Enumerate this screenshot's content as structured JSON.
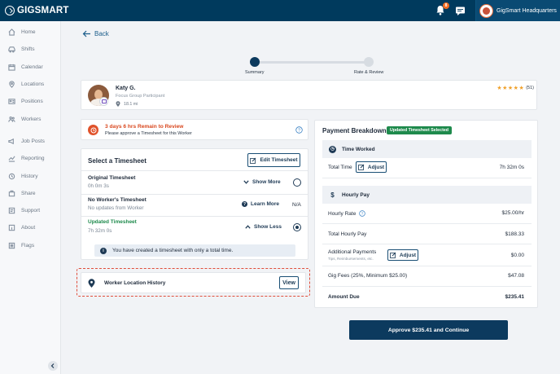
{
  "brand": {
    "name": "GIGSMART"
  },
  "header": {
    "notification_count": "8",
    "org_name": "GigSmart Headquarters"
  },
  "sidebar": {
    "items": [
      {
        "label": "Home",
        "icon": "home-icon"
      },
      {
        "label": "Shifts",
        "icon": "car-icon"
      },
      {
        "label": "Calendar",
        "icon": "calendar-icon"
      },
      {
        "label": "Locations",
        "icon": "location-pin-icon"
      },
      {
        "label": "Positions",
        "icon": "id-card-icon"
      },
      {
        "label": "Workers",
        "icon": "people-icon"
      },
      {
        "label": "Job Posts",
        "icon": "megaphone-icon"
      },
      {
        "label": "Reporting",
        "icon": "chart-icon"
      },
      {
        "label": "History",
        "icon": "history-icon"
      },
      {
        "label": "Share",
        "icon": "share-icon"
      },
      {
        "label": "Support",
        "icon": "support-icon"
      },
      {
        "label": "About",
        "icon": "info-icon"
      },
      {
        "label": "Flags",
        "icon": "flag-icon"
      }
    ]
  },
  "nav": {
    "back_label": "Back"
  },
  "stepper": {
    "steps": [
      "Summary",
      "Rate & Review"
    ],
    "active_index": 0
  },
  "worker": {
    "name": "Katy G.",
    "role": "Focus Group Participant",
    "distance": "18.1 mi",
    "rating": 5,
    "review_count": "(51)"
  },
  "alert": {
    "title": "3 days 6 hrs Remain to Review",
    "subtitle": "Please approve a Timesheet for this Worker"
  },
  "timesheet": {
    "title": "Select a Timesheet",
    "edit_label": "Edit Timesheet",
    "rows": [
      {
        "title": "Original Timesheet",
        "subtitle": "0h 0m 3s",
        "action": "Show More",
        "selected": false
      },
      {
        "title": "No Worker's Timesheet",
        "subtitle": "No updates from Worker",
        "action": "Learn More",
        "status": "N/A"
      },
      {
        "title": "Updated Timesheet",
        "subtitle": "7h 32m 0s",
        "action": "Show Less",
        "selected": true
      }
    ],
    "info": "You have created a timesheet with only a total time."
  },
  "location_history": {
    "title": "Worker Location History",
    "view_label": "View"
  },
  "payment": {
    "title": "Payment Breakdown",
    "badge": "Updated Timesheet Selected",
    "time_worked": {
      "heading": "Time Worked",
      "total_label": "Total Time",
      "adjust_label": "Adjust",
      "total_value": "7h 32m 0s"
    },
    "hourly_pay": {
      "heading": "Hourly Pay",
      "hourly_rate_label": "Hourly Rate",
      "hourly_rate_value": "$25.00/hr",
      "total_hourly_label": "Total Hourly Pay",
      "total_hourly_value": "$188.33",
      "additional_label": "Additional Payments",
      "additional_sub": "Tips, Reimbursements, etc.",
      "additional_adjust": "Adjust",
      "additional_value": "$0.00",
      "fees_label": "Gig Fees (25%, Minimum $25.00)",
      "fees_value": "$47.08",
      "amount_due_label": "Amount Due",
      "amount_due_value": "$235.41"
    }
  },
  "approve_label": "Approve $235.41 and Continue",
  "colors": {
    "header": "#003a5d",
    "accent_orange": "#f26c21",
    "alert_red": "#d9481f",
    "success_green": "#1e8a4c",
    "updated_green": "#1e8a4c",
    "primary_button": "#0c3a5e",
    "star": "#f0a12b"
  }
}
